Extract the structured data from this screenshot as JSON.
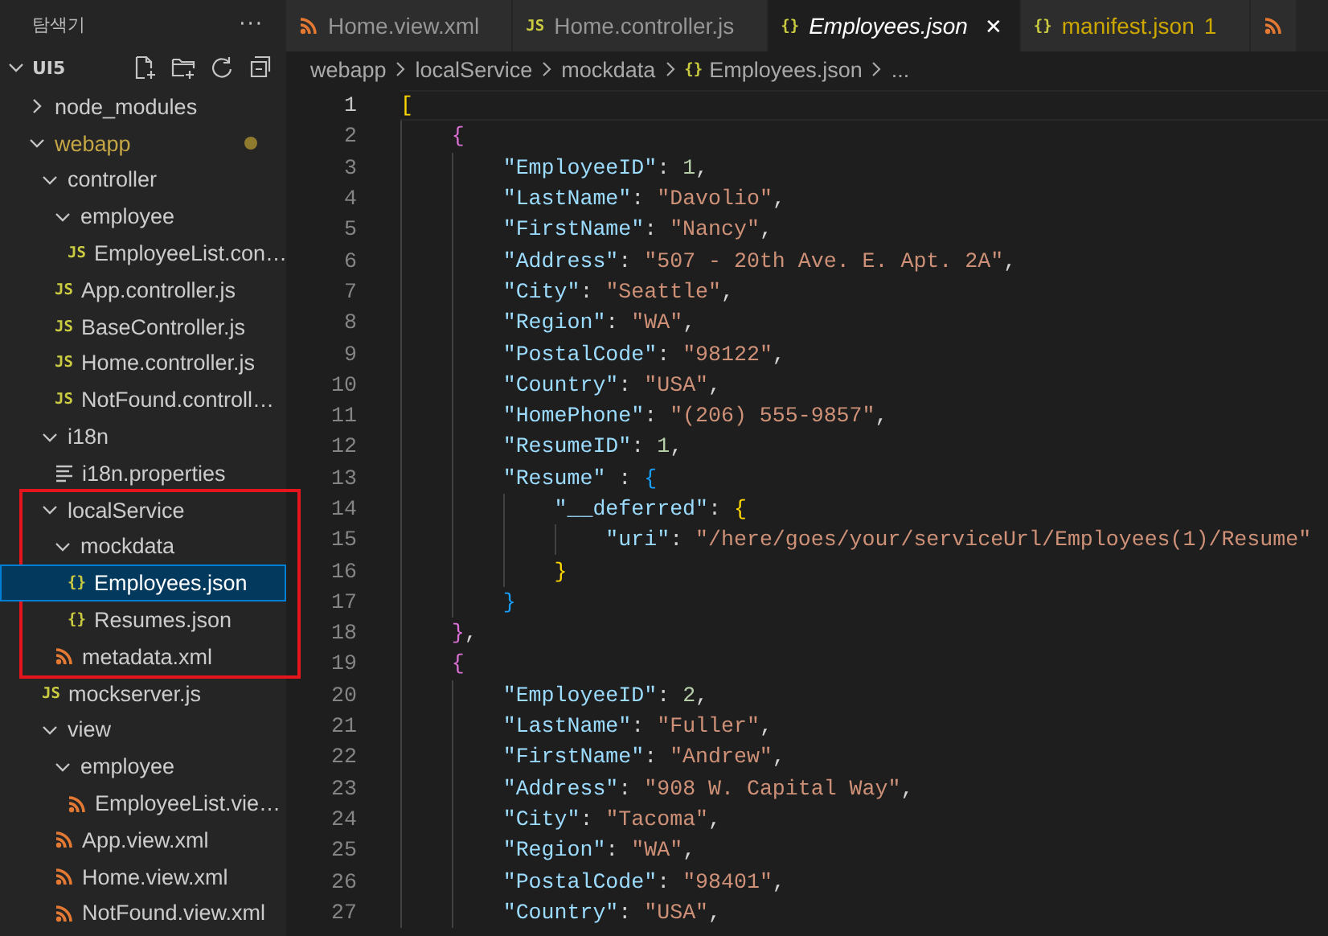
{
  "sidebar": {
    "title": "탐색기",
    "more": "···",
    "root": {
      "label": "UI5",
      "expanded": true
    },
    "items": [
      {
        "label": "node_modules",
        "kind": "folder",
        "expanded": false,
        "selected": false
      },
      {
        "label": "webapp",
        "kind": "folder",
        "expanded": true,
        "modified": true,
        "selected": false,
        "children": [
          {
            "label": "controller",
            "kind": "folder",
            "expanded": true,
            "selected": false,
            "children": [
              {
                "label": "employee",
                "kind": "folder",
                "expanded": true,
                "selected": false,
                "children": [
                  {
                    "label": "EmployeeList.con…",
                    "kind": "js",
                    "icon": "JS",
                    "selected": false
                  }
                ]
              },
              {
                "label": "App.controller.js",
                "kind": "js",
                "icon": "JS",
                "selected": false
              },
              {
                "label": "BaseController.js",
                "kind": "js",
                "icon": "JS",
                "selected": false
              },
              {
                "label": "Home.controller.js",
                "kind": "js",
                "icon": "JS",
                "selected": false
              },
              {
                "label": "NotFound.controll…",
                "kind": "js",
                "icon": "JS",
                "selected": false
              }
            ]
          },
          {
            "label": "i18n",
            "kind": "folder",
            "expanded": true,
            "selected": false,
            "children": [
              {
                "label": "i18n.properties",
                "kind": "props",
                "selected": false
              }
            ]
          },
          {
            "label": "localService",
            "kind": "folder",
            "expanded": true,
            "annotated": true,
            "selected": false,
            "children": [
              {
                "label": "mockdata",
                "kind": "folder",
                "expanded": true,
                "selected": false,
                "children": [
                  {
                    "label": "Employees.json",
                    "kind": "json",
                    "icon": "{}",
                    "selected": true
                  },
                  {
                    "label": "Resumes.json",
                    "kind": "json",
                    "icon": "{}",
                    "selected": false
                  }
                ]
              },
              {
                "label": "metadata.xml",
                "kind": "xml",
                "selected": false
              }
            ]
          },
          {
            "label": "mockserver.js",
            "kind": "js",
            "icon": "JS",
            "selected": false
          },
          {
            "label": "view",
            "kind": "folder",
            "expanded": true,
            "selected": false,
            "children": [
              {
                "label": "employee",
                "kind": "folder",
                "expanded": true,
                "selected": false,
                "children": [
                  {
                    "label": "EmployeeList.vie…",
                    "kind": "xml",
                    "selected": false
                  }
                ]
              },
              {
                "label": "App.view.xml",
                "kind": "xml",
                "selected": false
              },
              {
                "label": "Home.view.xml",
                "kind": "xml",
                "selected": false
              },
              {
                "label": "NotFound.view.xml",
                "kind": "xml",
                "selected": false
              }
            ]
          }
        ]
      }
    ]
  },
  "tabs": [
    {
      "label": "Home.view.xml",
      "kind": "xml",
      "selected": false
    },
    {
      "label": "Home.controller.js",
      "kind": "js",
      "icon": "JS",
      "selected": false
    },
    {
      "label": "Employees.json",
      "kind": "json",
      "icon": "{}",
      "selected": true,
      "preview": true,
      "close": "✕"
    },
    {
      "label": "manifest.json",
      "kind": "json",
      "icon": "{}",
      "selected": false,
      "warning": true,
      "problems": "1"
    },
    {
      "kind": "xml",
      "selected": false
    }
  ],
  "breadcrumb": [
    {
      "label": "webapp"
    },
    {
      "label": "localService"
    },
    {
      "label": "mockdata"
    },
    {
      "label": "Employees.json",
      "kind": "json",
      "icon": "{}"
    },
    {
      "label": "..."
    }
  ],
  "editor": {
    "lines": [
      {
        "number": "1",
        "current": true,
        "tokens": [
          {
            "kind": "bracket",
            "text": "[",
            "color": "#ffd700"
          }
        ]
      },
      {
        "number": "2",
        "tokens": [
          {
            "kind": "bracket",
            "text": "    {",
            "color": "#da70d6"
          }
        ]
      },
      {
        "number": "3",
        "tokens": [
          {
            "kind": "key",
            "text": "        \"EmployeeID\""
          },
          {
            "kind": "punct",
            "text": ": "
          },
          {
            "kind": "number",
            "text": "1"
          },
          {
            "kind": "punct",
            "text": ","
          }
        ]
      },
      {
        "number": "4",
        "tokens": [
          {
            "kind": "key",
            "text": "        \"LastName\""
          },
          {
            "kind": "punct",
            "text": ": "
          },
          {
            "kind": "string",
            "text": "\"Davolio\""
          },
          {
            "kind": "punct",
            "text": ","
          }
        ]
      },
      {
        "number": "5",
        "tokens": [
          {
            "kind": "key",
            "text": "        \"FirstName\""
          },
          {
            "kind": "punct",
            "text": ": "
          },
          {
            "kind": "string",
            "text": "\"Nancy\""
          },
          {
            "kind": "punct",
            "text": ","
          }
        ]
      },
      {
        "number": "6",
        "tokens": [
          {
            "kind": "key",
            "text": "        \"Address\""
          },
          {
            "kind": "punct",
            "text": ": "
          },
          {
            "kind": "string",
            "text": "\"507 - 20th Ave. E. Apt. 2A\""
          },
          {
            "kind": "punct",
            "text": ","
          }
        ]
      },
      {
        "number": "7",
        "tokens": [
          {
            "kind": "key",
            "text": "        \"City\""
          },
          {
            "kind": "punct",
            "text": ": "
          },
          {
            "kind": "string",
            "text": "\"Seattle\""
          },
          {
            "kind": "punct",
            "text": ","
          }
        ]
      },
      {
        "number": "8",
        "tokens": [
          {
            "kind": "key",
            "text": "        \"Region\""
          },
          {
            "kind": "punct",
            "text": ": "
          },
          {
            "kind": "string",
            "text": "\"WA\""
          },
          {
            "kind": "punct",
            "text": ","
          }
        ]
      },
      {
        "number": "9",
        "tokens": [
          {
            "kind": "key",
            "text": "        \"PostalCode\""
          },
          {
            "kind": "punct",
            "text": ": "
          },
          {
            "kind": "string",
            "text": "\"98122\""
          },
          {
            "kind": "punct",
            "text": ","
          }
        ]
      },
      {
        "number": "10",
        "tokens": [
          {
            "kind": "key",
            "text": "        \"Country\""
          },
          {
            "kind": "punct",
            "text": ": "
          },
          {
            "kind": "string",
            "text": "\"USA\""
          },
          {
            "kind": "punct",
            "text": ","
          }
        ]
      },
      {
        "number": "11",
        "tokens": [
          {
            "kind": "key",
            "text": "        \"HomePhone\""
          },
          {
            "kind": "punct",
            "text": ": "
          },
          {
            "kind": "string",
            "text": "\"(206) 555-9857\""
          },
          {
            "kind": "punct",
            "text": ","
          }
        ]
      },
      {
        "number": "12",
        "tokens": [
          {
            "kind": "key",
            "text": "        \"ResumeID\""
          },
          {
            "kind": "punct",
            "text": ": "
          },
          {
            "kind": "number",
            "text": "1"
          },
          {
            "kind": "punct",
            "text": ","
          }
        ]
      },
      {
        "number": "13",
        "tokens": [
          {
            "kind": "key",
            "text": "        \"Resume\""
          },
          {
            "kind": "punct",
            "text": " : "
          },
          {
            "kind": "bracket",
            "text": "{",
            "color": "#179fff"
          }
        ]
      },
      {
        "number": "14",
        "tokens": [
          {
            "kind": "key",
            "text": "            \"__deferred\""
          },
          {
            "kind": "punct",
            "text": ": "
          },
          {
            "kind": "bracket",
            "text": "{",
            "color": "#ffd700"
          }
        ]
      },
      {
        "number": "15",
        "tokens": [
          {
            "kind": "key",
            "text": "                \"uri\""
          },
          {
            "kind": "punct",
            "text": ": "
          },
          {
            "kind": "string",
            "text": "\"/here/goes/your/serviceUrl/Employees(1)/Resume\""
          }
        ]
      },
      {
        "number": "16",
        "tokens": [
          {
            "kind": "bracket",
            "text": "            }",
            "color": "#ffd700"
          }
        ]
      },
      {
        "number": "17",
        "tokens": [
          {
            "kind": "bracket",
            "text": "        }",
            "color": "#179fff"
          }
        ]
      },
      {
        "number": "18",
        "tokens": [
          {
            "kind": "bracket",
            "text": "    }",
            "color": "#da70d6"
          },
          {
            "kind": "punct",
            "text": ","
          }
        ]
      },
      {
        "number": "19",
        "tokens": [
          {
            "kind": "bracket",
            "text": "    {",
            "color": "#da70d6"
          }
        ]
      },
      {
        "number": "20",
        "tokens": [
          {
            "kind": "key",
            "text": "        \"EmployeeID\""
          },
          {
            "kind": "punct",
            "text": ": "
          },
          {
            "kind": "number",
            "text": "2"
          },
          {
            "kind": "punct",
            "text": ","
          }
        ]
      },
      {
        "number": "21",
        "tokens": [
          {
            "kind": "key",
            "text": "        \"LastName\""
          },
          {
            "kind": "punct",
            "text": ": "
          },
          {
            "kind": "string",
            "text": "\"Fuller\""
          },
          {
            "kind": "punct",
            "text": ","
          }
        ]
      },
      {
        "number": "22",
        "tokens": [
          {
            "kind": "key",
            "text": "        \"FirstName\""
          },
          {
            "kind": "punct",
            "text": ": "
          },
          {
            "kind": "string",
            "text": "\"Andrew\""
          },
          {
            "kind": "punct",
            "text": ","
          }
        ]
      },
      {
        "number": "23",
        "tokens": [
          {
            "kind": "key",
            "text": "        \"Address\""
          },
          {
            "kind": "punct",
            "text": ": "
          },
          {
            "kind": "string",
            "text": "\"908 W. Capital Way\""
          },
          {
            "kind": "punct",
            "text": ","
          }
        ]
      },
      {
        "number": "24",
        "tokens": [
          {
            "kind": "key",
            "text": "        \"City\""
          },
          {
            "kind": "punct",
            "text": ": "
          },
          {
            "kind": "string",
            "text": "\"Tacoma\""
          },
          {
            "kind": "punct",
            "text": ","
          }
        ]
      },
      {
        "number": "25",
        "tokens": [
          {
            "kind": "key",
            "text": "        \"Region\""
          },
          {
            "kind": "punct",
            "text": ": "
          },
          {
            "kind": "string",
            "text": "\"WA\""
          },
          {
            "kind": "punct",
            "text": ","
          }
        ]
      },
      {
        "number": "26",
        "tokens": [
          {
            "kind": "key",
            "text": "        \"PostalCode\""
          },
          {
            "kind": "punct",
            "text": ": "
          },
          {
            "kind": "string",
            "text": "\"98401\""
          },
          {
            "kind": "punct",
            "text": ","
          }
        ]
      },
      {
        "number": "27",
        "tokens": [
          {
            "kind": "key",
            "text": "        \"Country\""
          },
          {
            "kind": "punct",
            "text": ": "
          },
          {
            "kind": "string",
            "text": "\"USA\""
          },
          {
            "kind": "punct",
            "text": ","
          }
        ]
      }
    ]
  }
}
